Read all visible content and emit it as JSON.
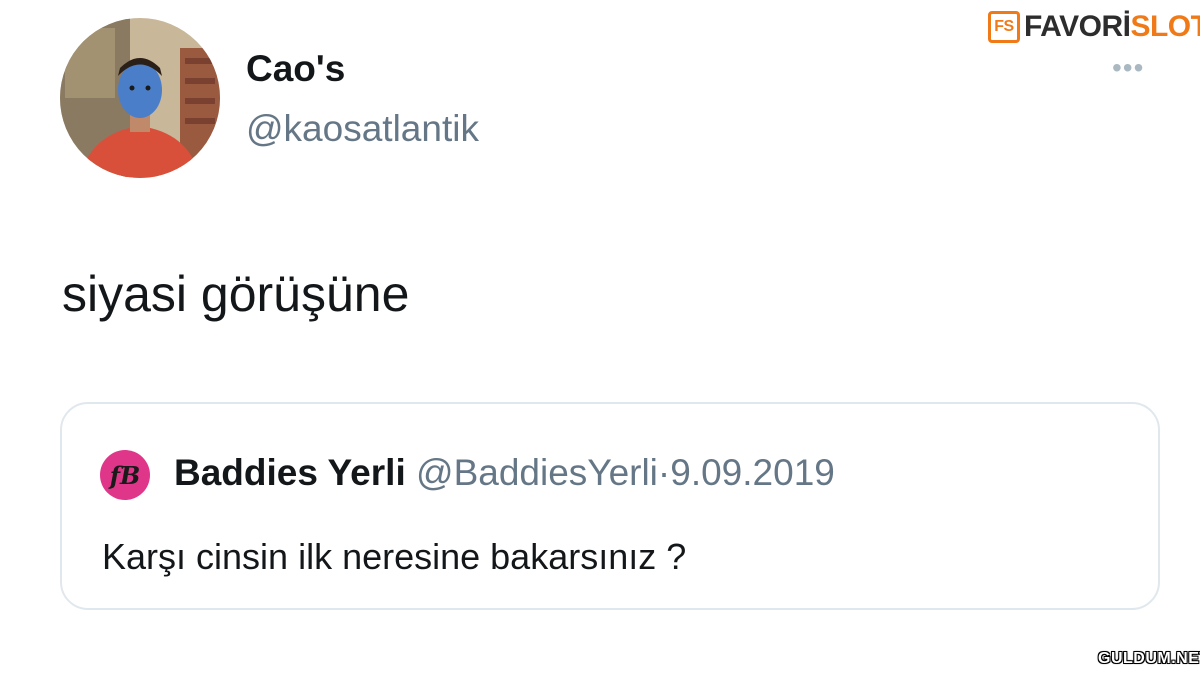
{
  "tweet": {
    "author_name": "Cao's",
    "author_handle": "@kaosatlantik",
    "more_label": "•••",
    "text": "siyasi görüşüne"
  },
  "quoted_tweet": {
    "avatar_initials": "fB",
    "author_name": "Baddies Yerli",
    "author_handle": "@BaddiesYerli",
    "separator": "·",
    "date": "9.09.2019",
    "text": "Karşı cinsin ilk neresine bakarsınız ?"
  },
  "branding": {
    "logo_mark": "FS",
    "logo_part1": "FAVORİ",
    "logo_part2": "SLOT",
    "watermark": "GULDUM.NET"
  },
  "colors": {
    "handle_gray": "#657786",
    "border": "#e1e8ed",
    "quote_avatar": "#e0368a",
    "brand_orange": "#f07a18"
  }
}
